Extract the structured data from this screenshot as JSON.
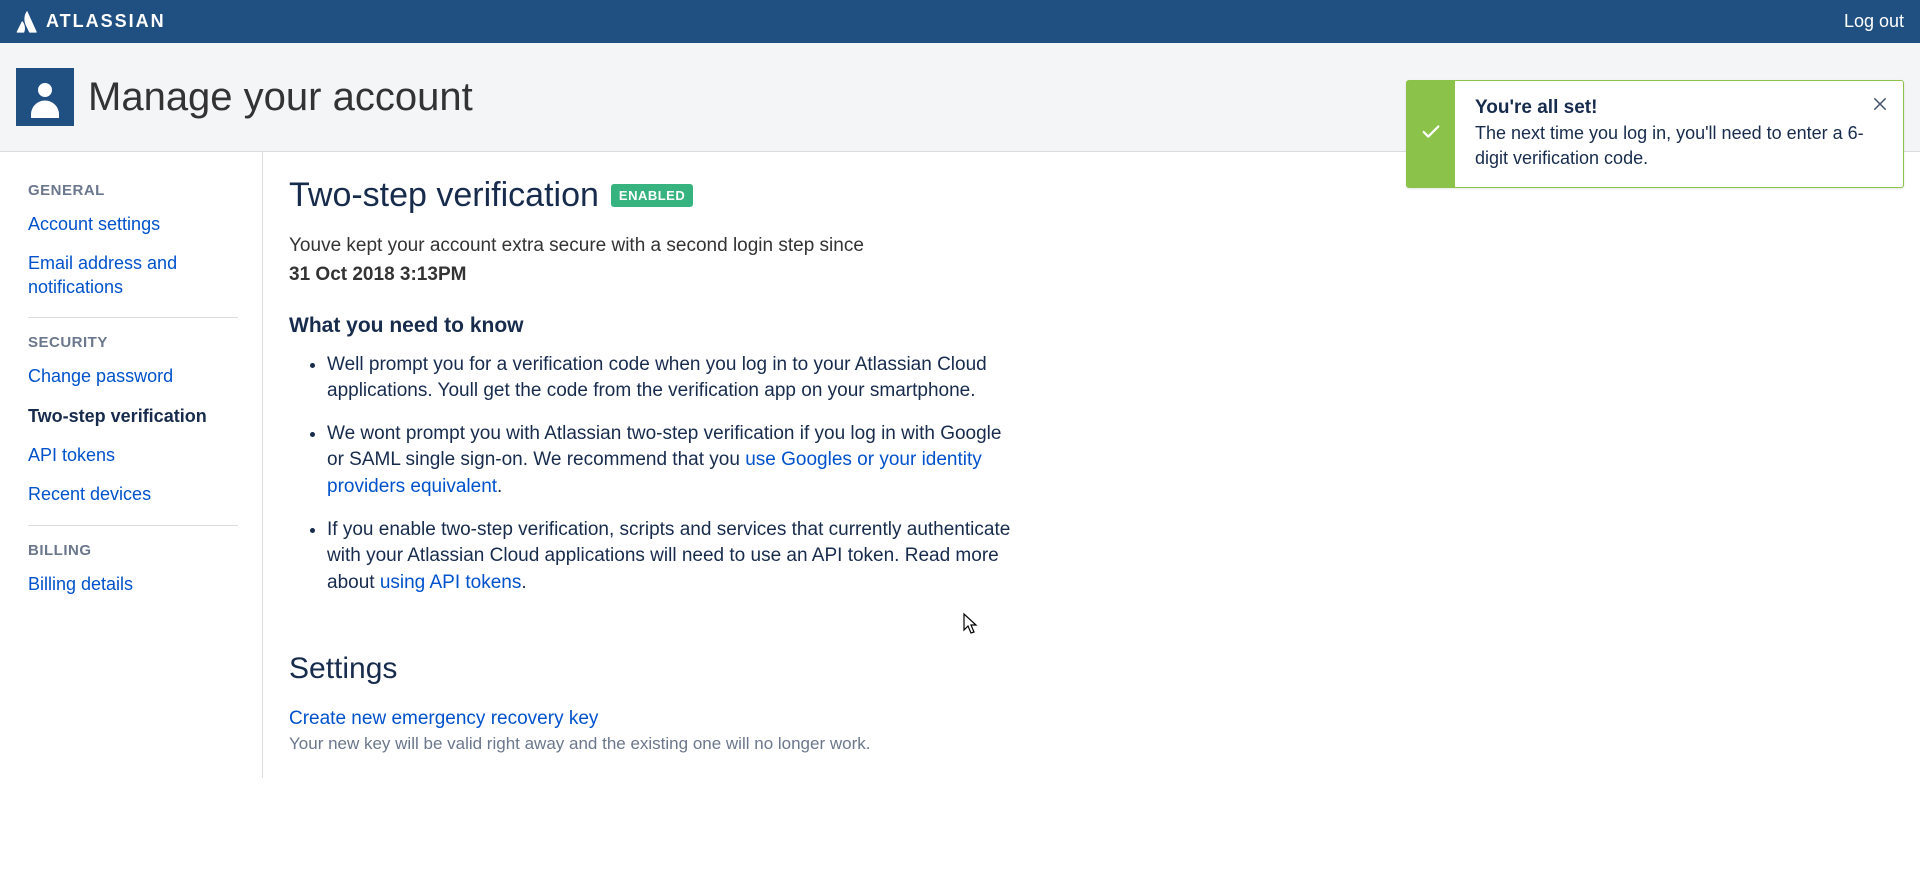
{
  "brand": {
    "name": "ATLASSIAN"
  },
  "top": {
    "logout": "Log out"
  },
  "header": {
    "title": "Manage your account"
  },
  "sidebar": {
    "general_heading": "GENERAL",
    "security_heading": "SECURITY",
    "billing_heading": "BILLING",
    "items": {
      "account_settings": "Account settings",
      "email_notifications": "Email address and notifications",
      "change_password": "Change password",
      "two_step": "Two-step verification",
      "api_tokens": "API tokens",
      "recent_devices": "Recent devices",
      "billing_details": "Billing details"
    }
  },
  "main": {
    "title": "Two-step verification",
    "badge": "ENABLED",
    "intro": "Youve kept your account extra secure with a second login step since",
    "since_date": "31 Oct 2018 3:13PM",
    "what_heading": "What you need to know",
    "bullets": {
      "b1": "Well prompt you for a verification code when you log in to your Atlassian Cloud applications. Youll get the code from the verification app on your smartphone.",
      "b2a": "We wont prompt you with Atlassian two-step verification if you log in with Google or SAML single sign-on. We recommend that you ",
      "b2link": "use Googles or your identity providers equivalent",
      "b2b": ".",
      "b3a": "If you enable two-step verification, scripts and services that currently authenticate with your Atlassian Cloud applications will need to use an API token. Read more about ",
      "b3link": "using API tokens",
      "b3b": "."
    },
    "settings_heading": "Settings",
    "recovery_link": "Create new emergency recovery key",
    "recovery_desc": "Your new key will be valid right away and the existing one will no longer work."
  },
  "toast": {
    "title": "You're all set!",
    "message": "The next time you log in, you'll need to enter a 6-digit verification code."
  }
}
